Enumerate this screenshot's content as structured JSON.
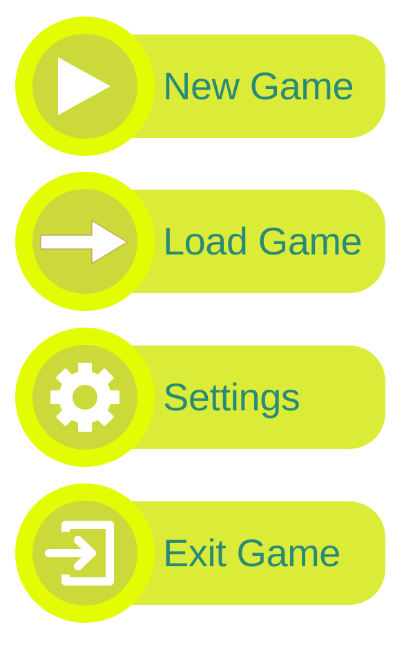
{
  "menu": {
    "items": [
      {
        "label": "New Game",
        "icon": "play-icon"
      },
      {
        "label": "Load Game",
        "icon": "arrow-right-icon"
      },
      {
        "label": "Settings",
        "icon": "gear-icon"
      },
      {
        "label": "Exit Game",
        "icon": "exit-icon"
      }
    ]
  },
  "colors": {
    "outer_ring": "#e3fb03",
    "inner_circle": "#cbd93a",
    "pill": "#dbec38",
    "label_text": "#2a8a78",
    "icon": "#ffffff"
  }
}
